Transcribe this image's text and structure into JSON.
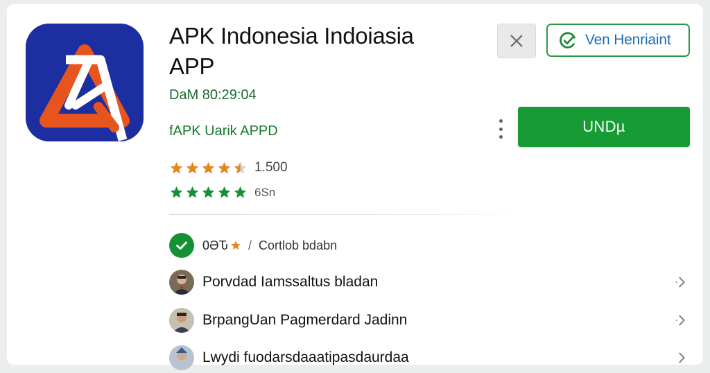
{
  "app": {
    "title_line1": "APK Indonesia Indoiasia",
    "title_line2": "APP",
    "developer": "DaM 80:29:04",
    "tagline": "fAPK Uarik APPD",
    "icon": "stylized-A-logo"
  },
  "ratings": {
    "primary": {
      "stars": 4.5,
      "count": "1.500",
      "color": "#e8861a"
    },
    "secondary": {
      "stars": 5,
      "count": "6Sn",
      "color": "#1a8f3a"
    }
  },
  "actions": {
    "close_icon": "close-icon",
    "open_label": "Ven Henriaint",
    "open_icon": "refresh-check-icon",
    "install_label": "UNDµ",
    "more_icon": "more-vert-icon"
  },
  "list": {
    "verified": {
      "code": "0ӘԎ",
      "separator": "/",
      "text": "Cortlob bdabn",
      "icon": "check-circle-icon"
    },
    "items": [
      {
        "label": "Porvdad Iamssaltus bladan",
        "icon": "chevron-right-icon"
      },
      {
        "label": "BrpangUan Pagmerdard Jadinn",
        "icon": "chevron-right-icon"
      },
      {
        "label": "Lwydi fuodarsdaaatipasdaurdaa",
        "icon": "chevron-right-icon"
      }
    ]
  },
  "colors": {
    "accent_green": "#179c35",
    "open_border": "#2b9a44",
    "icon_bg": "#1d2fa0",
    "icon_orange": "#e8541e"
  }
}
